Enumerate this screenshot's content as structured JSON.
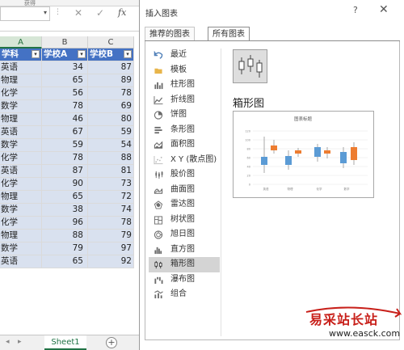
{
  "excel": {
    "ribbon_label": "获得",
    "formula_buttons": [
      "✕",
      "✓",
      "fx"
    ],
    "columns": [
      "A",
      "B",
      "C"
    ],
    "header": [
      "学科",
      "学校A",
      "学校B"
    ],
    "rows": [
      [
        "英语",
        "34",
        "87"
      ],
      [
        "物理",
        "65",
        "89"
      ],
      [
        "化学",
        "56",
        "78"
      ],
      [
        "数学",
        "78",
        "69"
      ],
      [
        "物理",
        "46",
        "80"
      ],
      [
        "英语",
        "67",
        "59"
      ],
      [
        "数学",
        "59",
        "54"
      ],
      [
        "化学",
        "78",
        "88"
      ],
      [
        "英语",
        "87",
        "81"
      ],
      [
        "化学",
        "90",
        "73"
      ],
      [
        "物理",
        "65",
        "72"
      ],
      [
        "数学",
        "38",
        "74"
      ],
      [
        "化学",
        "96",
        "78"
      ],
      [
        "物理",
        "88",
        "79"
      ],
      [
        "数学",
        "79",
        "97"
      ],
      [
        "英语",
        "65",
        "92"
      ]
    ],
    "sheet_tab": "Sheet1",
    "add_sheet": "+"
  },
  "dialog": {
    "title": "插入图表",
    "help": "?",
    "close": "✕",
    "tabs": [
      "推荐的图表",
      "所有图表"
    ],
    "active_tab": "所有图表",
    "chart_types": [
      {
        "label": "最近",
        "icon": "undo-icon"
      },
      {
        "label": "模板",
        "icon": "folder-icon"
      },
      {
        "label": "柱形图",
        "icon": "column-chart-icon"
      },
      {
        "label": "折线图",
        "icon": "line-chart-icon"
      },
      {
        "label": "饼图",
        "icon": "pie-chart-icon"
      },
      {
        "label": "条形图",
        "icon": "bar-chart-icon"
      },
      {
        "label": "面积图",
        "icon": "area-chart-icon"
      },
      {
        "label": "X Y (散点图)",
        "icon": "scatter-chart-icon"
      },
      {
        "label": "股价图",
        "icon": "stock-chart-icon"
      },
      {
        "label": "曲面图",
        "icon": "surface-chart-icon"
      },
      {
        "label": "雷达图",
        "icon": "radar-chart-icon"
      },
      {
        "label": "树状图",
        "icon": "treemap-chart-icon"
      },
      {
        "label": "旭日图",
        "icon": "sunburst-chart-icon"
      },
      {
        "label": "直方图",
        "icon": "histogram-chart-icon"
      },
      {
        "label": "箱形图",
        "icon": "box-whisker-chart-icon"
      },
      {
        "label": "瀑布图",
        "icon": "waterfall-chart-icon"
      },
      {
        "label": "组合",
        "icon": "combo-chart-icon"
      }
    ],
    "selected_type": "箱形图",
    "preview_heading": "箱形图",
    "preview_chart": {
      "title": "图表标题",
      "y_ticks": [
        "0",
        "20",
        "40",
        "60",
        "80",
        "100",
        "120"
      ],
      "categories": [
        "英语",
        "物理",
        "化学",
        "数学"
      ],
      "series_colors": [
        "#5b9bd5",
        "#ed7d31"
      ]
    }
  },
  "watermark": {
    "text": "易采站长站",
    "url": "www.easck.com"
  }
}
